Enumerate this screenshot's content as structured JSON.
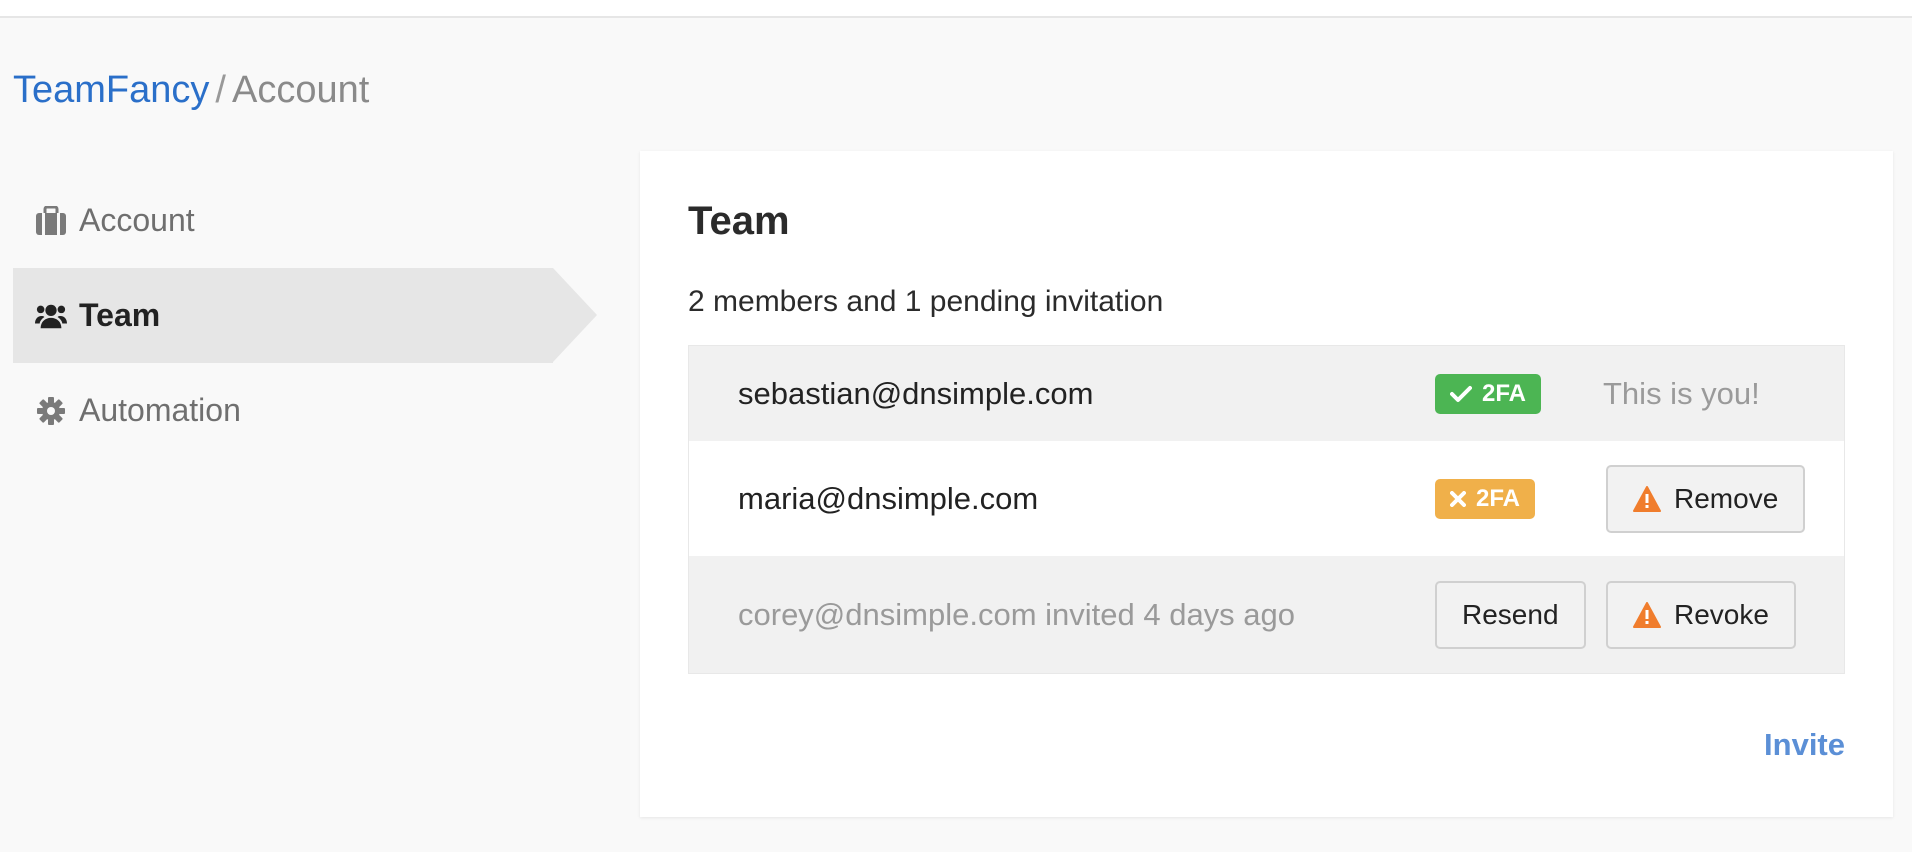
{
  "breadcrumb": {
    "team": "TeamFancy",
    "separator": "/",
    "current": "Account"
  },
  "sidebar": {
    "items": [
      {
        "label": "Account",
        "icon": "briefcase-icon",
        "active": false
      },
      {
        "label": "Team",
        "icon": "users-icon",
        "active": true
      },
      {
        "label": "Automation",
        "icon": "gear-icon",
        "active": false
      }
    ]
  },
  "panel": {
    "title": "Team",
    "summary": "2 members and 1 pending invitation",
    "members": [
      {
        "email": "sebastian@dnsimple.com",
        "twofa_label": "2FA",
        "twofa_enabled": true,
        "note": "This is you!"
      },
      {
        "email": "maria@dnsimple.com",
        "twofa_label": "2FA",
        "twofa_enabled": false,
        "action": "Remove"
      }
    ],
    "invitation": {
      "text": "corey@dnsimple.com invited 4 days ago",
      "resend_label": "Resend",
      "revoke_label": "Revoke"
    },
    "invite_label": "Invite"
  },
  "colors": {
    "link": "#2a6fc9",
    "twofa_ok": "#4cb553",
    "twofa_warn": "#f0b04a",
    "warning_icon": "#f07d2d",
    "invite": "#5b8fd6"
  }
}
